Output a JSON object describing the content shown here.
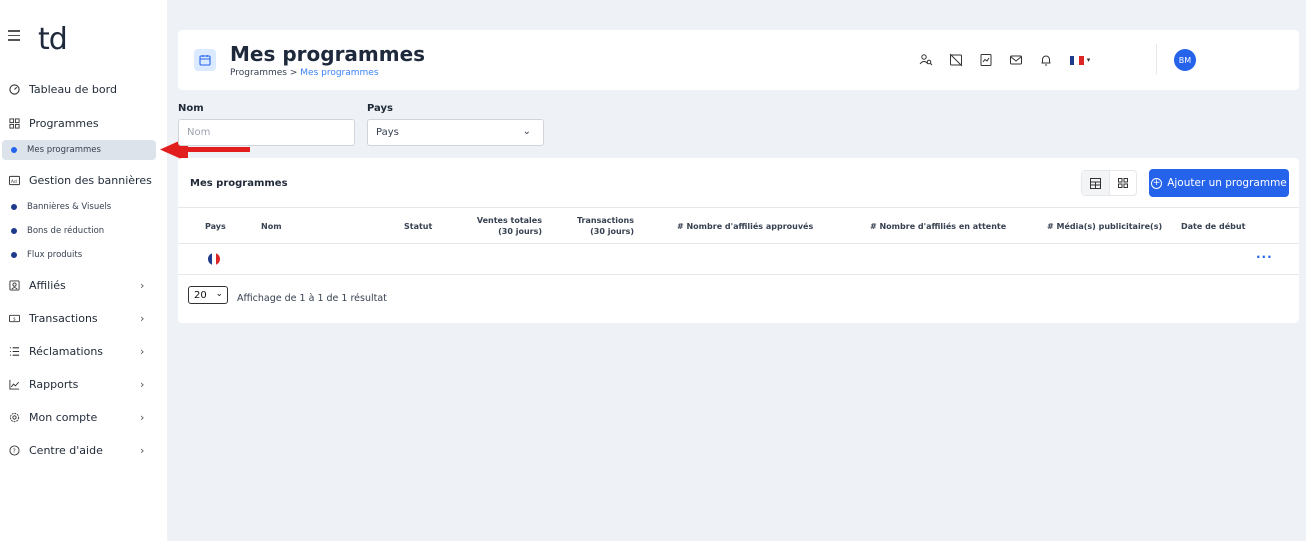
{
  "sidebar": {
    "logo": "td",
    "items": [
      {
        "label": "Tableau de bord",
        "icon": "dashboard-icon"
      },
      {
        "label": "Programmes",
        "icon": "grid-icon"
      },
      {
        "label": "Gestion des bannières",
        "icon": "ad-icon"
      },
      {
        "label": "Affiliés",
        "icon": "user-card-icon"
      },
      {
        "label": "Transactions",
        "icon": "money-icon"
      },
      {
        "label": "Réclamations",
        "icon": "list-icon"
      },
      {
        "label": "Rapports",
        "icon": "chart-icon"
      },
      {
        "label": "Mon compte",
        "icon": "gear-icon"
      },
      {
        "label": "Centre d'aide",
        "icon": "help-icon"
      }
    ],
    "sub_programmes": [
      "Mes programmes"
    ],
    "sub_bannieres": [
      "Bannières & Visuels",
      "Bons de réduction",
      "Flux produits"
    ]
  },
  "header": {
    "title": "Mes programmes",
    "breadcrumb_root": "Programmes",
    "breadcrumb_sep": ">",
    "breadcrumb_current": "Mes programmes",
    "avatar": "BM"
  },
  "filters": {
    "nom_label": "Nom",
    "nom_placeholder": "Nom",
    "pays_label": "Pays",
    "pays_value": "Pays"
  },
  "table": {
    "title": "Mes programmes",
    "add_button": "Ajouter un programme",
    "columns": {
      "pays": "Pays",
      "nom": "Nom",
      "statut": "Statut",
      "ventes_1": "Ventes totales",
      "ventes_2": "(30 jours)",
      "trans_1": "Transactions",
      "trans_2": "(30 jours)",
      "affilies_approuves": "# Nombre d'affiliés approuvés",
      "affilies_attente": "# Nombre d'affiliés en attente",
      "media": "# Média(s) publicitaire(s)",
      "date_debut": "Date de début"
    },
    "row_actions": "···",
    "per_page": "20",
    "results_text": "Affichage de 1 à 1 de 1 résultat"
  },
  "colors": {
    "accent": "#2563eb",
    "flag_blue": "#1e3a8a",
    "flag_red": "#dc2626",
    "arrow": "#e11d1d"
  }
}
